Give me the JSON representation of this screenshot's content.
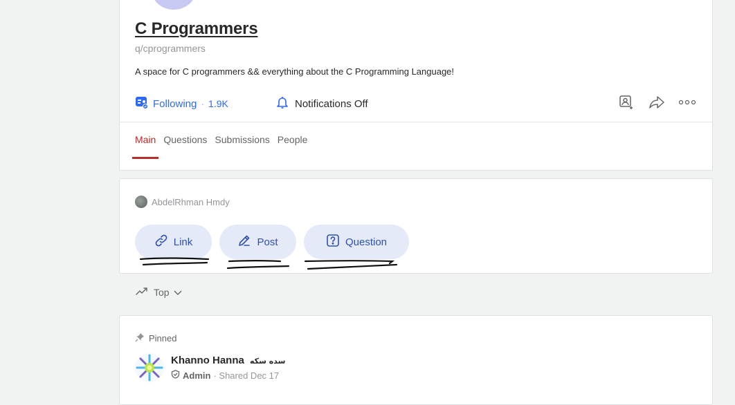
{
  "space": {
    "title": "C Programmers",
    "handle": "q/cprogrammers",
    "description": "A space for C programmers && everything about the C Programming Language!",
    "follow_label": "Following",
    "follow_sep": "·",
    "follower_count": "1.9K",
    "notifications_label": "Notifications Off"
  },
  "tabs": [
    {
      "label": "Main",
      "active": true
    },
    {
      "label": "Questions",
      "active": false
    },
    {
      "label": "Submissions",
      "active": false
    },
    {
      "label": "People",
      "active": false
    }
  ],
  "composer": {
    "user_name": "AbdelRhman Hmdy",
    "chips": [
      {
        "label": "Link",
        "icon": "link-icon"
      },
      {
        "label": "Post",
        "icon": "pencil-icon"
      },
      {
        "label": "Question",
        "icon": "question-icon"
      }
    ]
  },
  "feed": {
    "sort_label": "Top",
    "pinned_label": "Pinned",
    "post_author": "Khanno Hanna",
    "post_author_alt": "سده سکه",
    "post_role": "Admin",
    "post_meta": "· Shared Dec 17"
  },
  "colors": {
    "accent_blue": "#2e69ff",
    "active_tab_red": "#b92b27",
    "chip_bg": "#e4eaf8",
    "page_bg": "#f1f2f2"
  }
}
